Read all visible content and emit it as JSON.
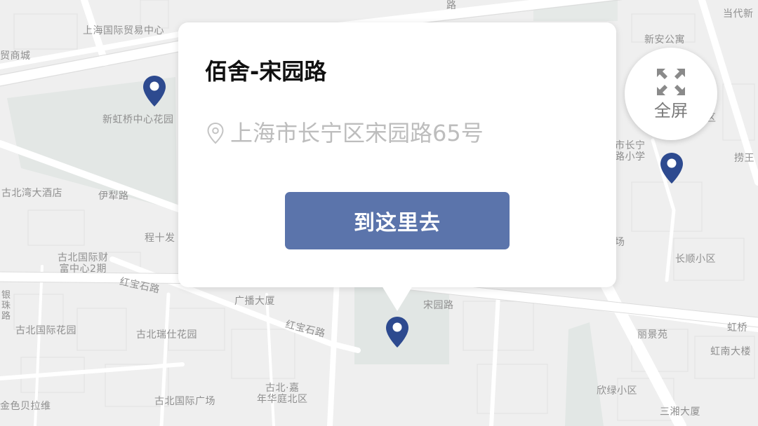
{
  "popup": {
    "title": "佰舍-宋园路",
    "address": "上海市长宁区宋园路65号",
    "go_button_label": "到这里去"
  },
  "fullscreen": {
    "label": "全屏",
    "icon": "expand-arrows-icon"
  },
  "map": {
    "labels": [
      "上海国际贸易中心",
      "贸商城",
      "新虹桥中心花园",
      "古北湾大酒店",
      "伊犁路",
      "程十发",
      "古北国际财\n富中心2期",
      "红宝石路",
      "广播大厦",
      "古北国际花园",
      "古北瑞仕花园",
      "红宝石路",
      "宋园路",
      "古北·嘉\n年华庭北区",
      "古北国际广场",
      "金色贝拉维",
      "新安公寓",
      "当代新",
      "区",
      "市长宁\n路小学",
      "捞王",
      "长顺小区",
      "场",
      "丽景苑",
      "虹桥",
      "虹南大楼",
      "欣绿小区",
      "三湘大厦",
      "路",
      "银\n珠\n路"
    ],
    "pin_color": "#2d4a8f",
    "pin_icon": "map-pin-icon"
  },
  "colors": {
    "accent": "#5b74ab",
    "pin": "#2d4a8f",
    "title": "#111111",
    "address": "#bdbdbd"
  }
}
